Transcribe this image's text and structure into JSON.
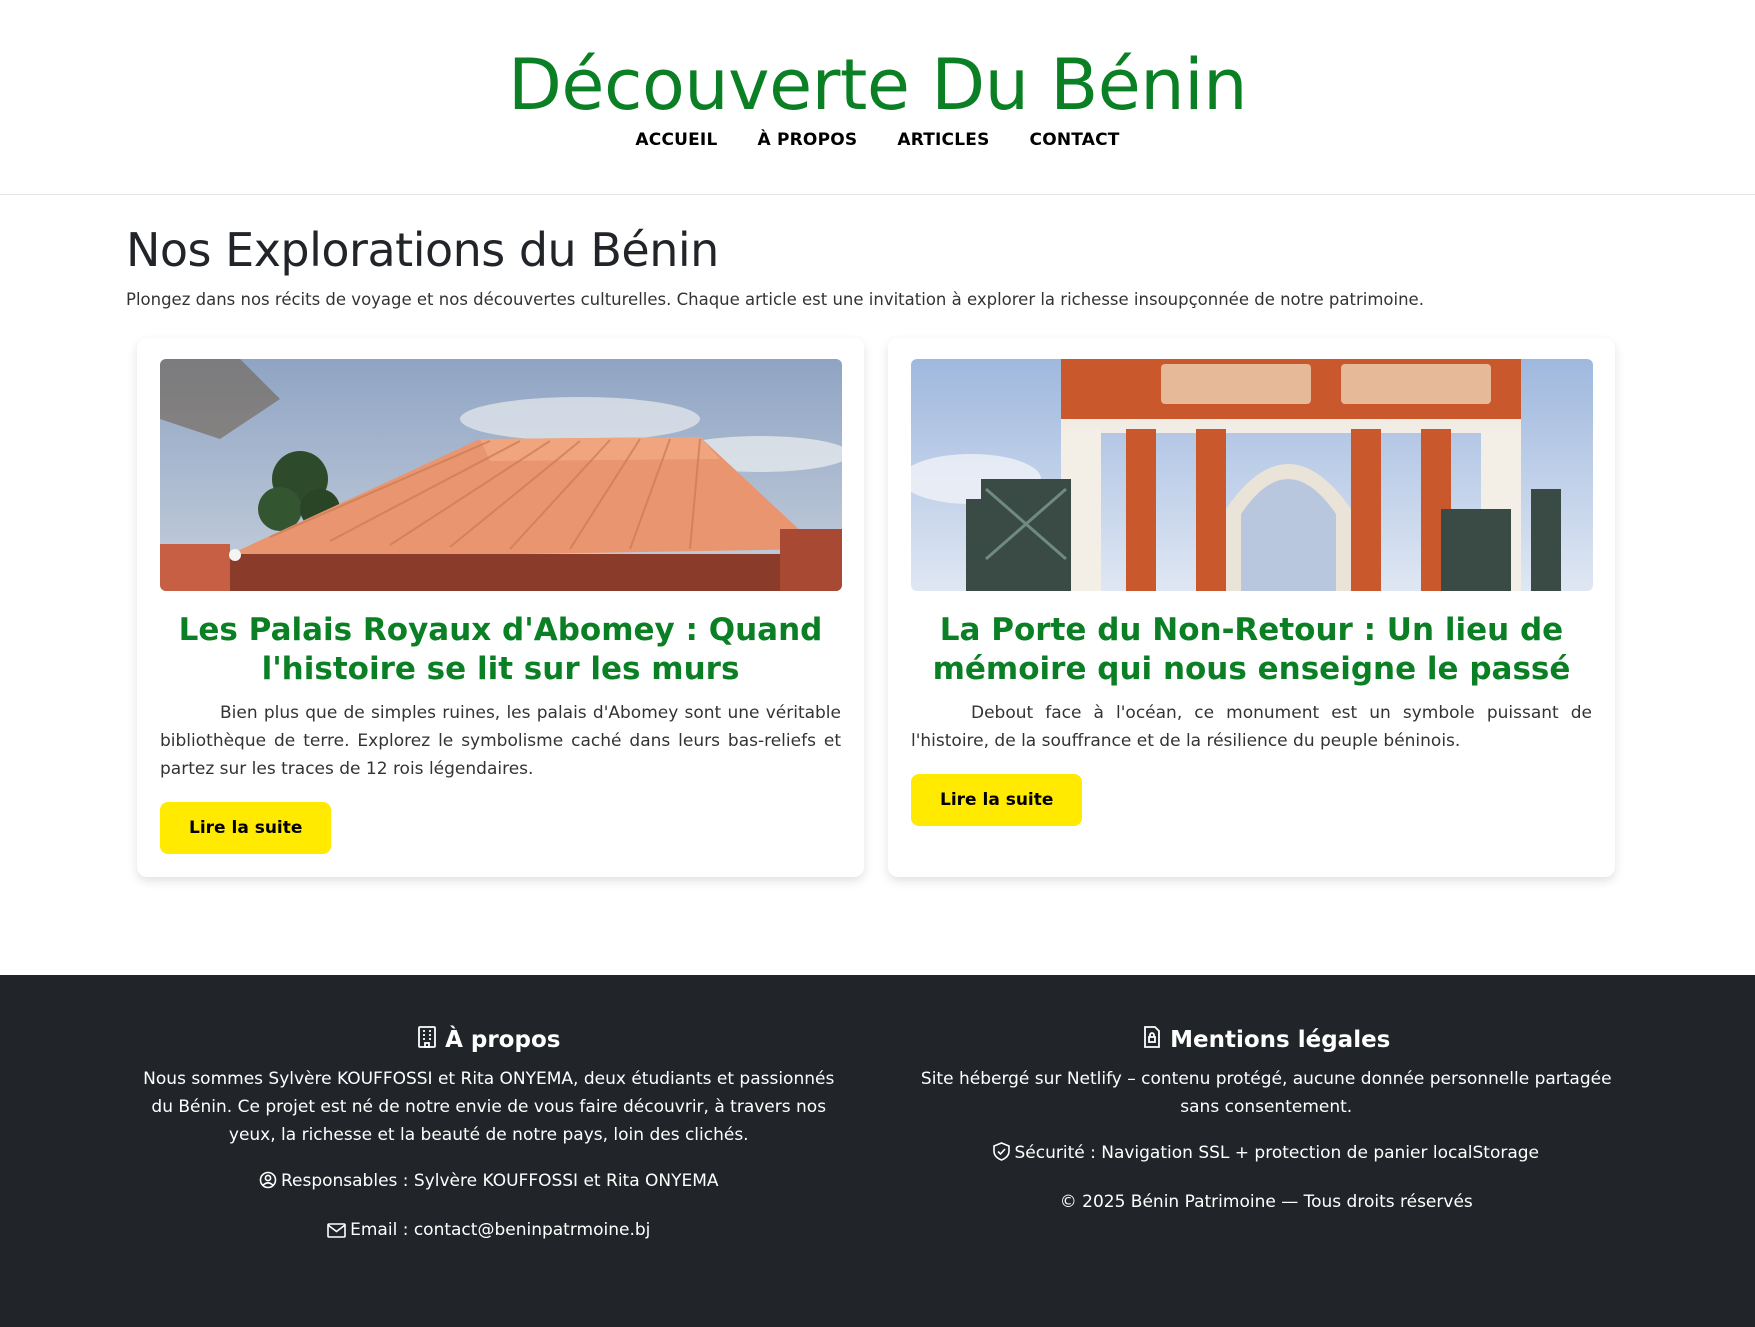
{
  "header": {
    "site_title": "Découverte Du Bénin",
    "nav": [
      "ACCUEIL",
      "À PROPOS",
      "ARTICLES",
      "CONTACT"
    ]
  },
  "main": {
    "title": "Nos Explorations du Bénin",
    "intro": "Plongez dans nos récits de voyage et nos découvertes culturelles. Chaque article est une invitation à explorer la richesse insoupçonnée de notre patrimoine."
  },
  "articles": [
    {
      "title": "Les Palais Royaux d'Abomey : Quand l'histoire se lit sur les murs",
      "text": "Bien plus que de simples ruines, les palais d'Abomey sont une véritable bibliothèque de terre. Explorez le symbolisme caché dans leurs bas-reliefs et partez sur les traces de 12 rois légendaires.",
      "button": "Lire la suite"
    },
    {
      "title": "La Porte du Non-Retour : Un lieu de mémoire qui nous enseigne le passé",
      "text": "Debout face à l'océan, ce monument est un symbole puissant de l'histoire, de la souffrance et de la résilience du peuple béninois.",
      "button": "Lire la suite"
    }
  ],
  "footer": {
    "about": {
      "heading": "À propos",
      "icon": "building-icon",
      "text": "Nous sommes Sylvère KOUFFOSSI et Rita ONYEMA, deux étudiants et passionnés du Bénin. Ce projet est né de notre envie de vous faire découvrir, à travers nos yeux, la richesse et la beauté de notre pays, loin des clichés.",
      "responsables": "Responsables : Sylvère KOUFFOSSI et Rita ONYEMA",
      "email": "Email : contact@beninpatrmoine.bj"
    },
    "legal": {
      "heading": "Mentions légales",
      "icon": "file-lock-icon",
      "text": "Site hébergé sur Netlify – contenu protégé, aucune donnée personnelle partagée sans consentement.",
      "security": "Sécurité : Navigation SSL + protection de panier localStorage",
      "copyright": "© 2025 Bénin Patrimoine — Tous droits réservés"
    }
  },
  "colors": {
    "brand_green": "#0a7f24",
    "button_yellow": "#ffea00",
    "footer_bg": "#212529"
  }
}
